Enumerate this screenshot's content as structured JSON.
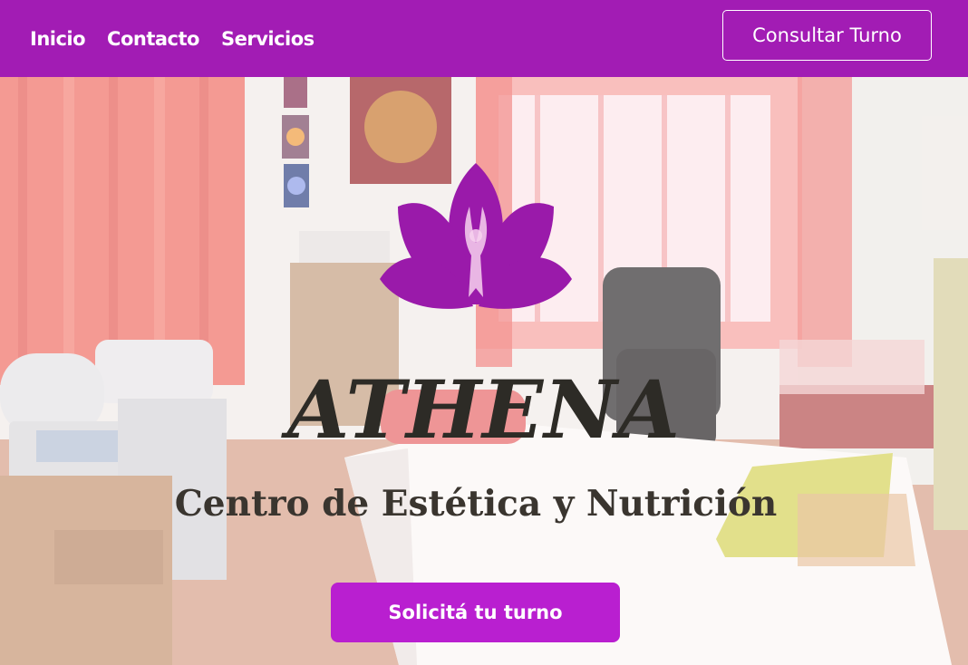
{
  "nav": {
    "links": [
      {
        "label": "Inicio"
      },
      {
        "label": "Contacto"
      },
      {
        "label": "Servicios"
      }
    ],
    "cta_label": "Consultar Turno"
  },
  "hero": {
    "title": "ATHENA",
    "subtitle": "Centro de Estética y Nutrición",
    "cta_label": "Solicitá tu turno"
  },
  "colors": {
    "nav_background": "#a21cb4",
    "button_purple": "#b91fd0",
    "logo_purple": "#9a1aaa",
    "text_dark": "#2d2b26"
  },
  "icons": {
    "logo": "lotus-flower-logo"
  }
}
